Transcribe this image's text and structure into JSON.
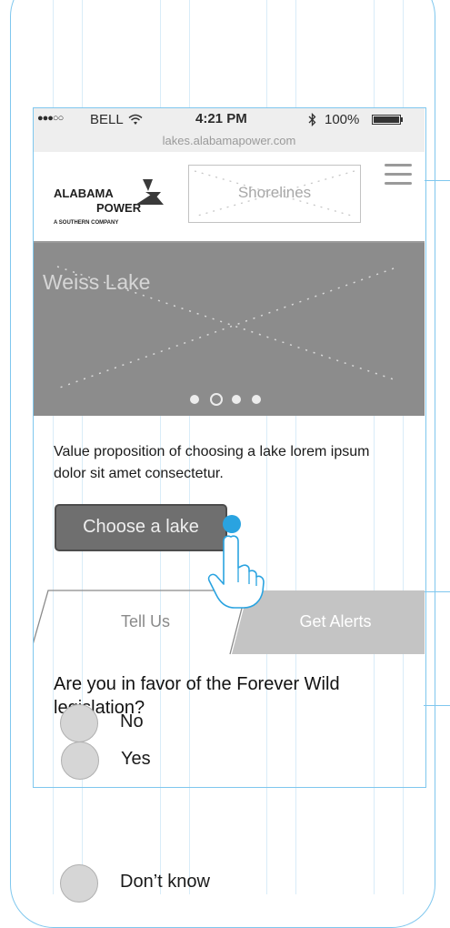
{
  "status_bar": {
    "signal": "●●●○○",
    "carrier": "BELL",
    "time": "4:21 PM",
    "battery": "100%"
  },
  "browser": {
    "url": "lakes.alabamapower.com"
  },
  "header": {
    "logo_line1": "ALABAMA",
    "logo_line2": "POWER",
    "logo_sub": "A SOUTHERN COMPANY",
    "section_placeholder": "Shorelines",
    "menu_icon": "hamburger-menu-icon"
  },
  "hero": {
    "title": "Weiss Lake",
    "carousel": {
      "count": 4,
      "active_index": 1
    }
  },
  "intro": {
    "text": "Value proposition of choosing a lake lorem ipsum dolor sit amet consectetur.",
    "cta_label": "Choose a lake"
  },
  "tabs": [
    {
      "label": "Tell Us",
      "active": true
    },
    {
      "label": "Get Alerts",
      "active": false
    }
  ],
  "poll": {
    "question": "Are you in favor of the Forever Wild legislation?",
    "options": [
      "Yes",
      "No",
      "Don’t know"
    ]
  },
  "colors": {
    "annotation_blue": "#7fc7ee",
    "hero_gray": "#8c8c8c",
    "button_gray": "#6f6f6f",
    "tap_dot": "#2aa3e0"
  }
}
